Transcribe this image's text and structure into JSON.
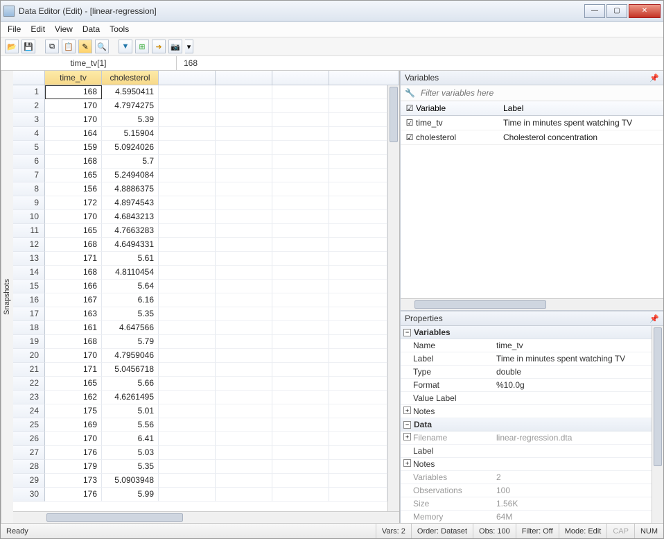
{
  "window": {
    "title": "Data Editor (Edit) - [linear-regression]"
  },
  "menu": [
    "File",
    "Edit",
    "View",
    "Data",
    "Tools"
  ],
  "toolbar_icons": [
    "open",
    "save",
    "copy",
    "paste",
    "editor-edit",
    "editor-browse",
    "filter",
    "vars-mgr",
    "find",
    "snapshot",
    "print"
  ],
  "cellbar": {
    "name": "time_tv[1]",
    "value": "168"
  },
  "columns": [
    "time_tv",
    "cholesterol"
  ],
  "rows": [
    {
      "n": 1,
      "time_tv": "168",
      "chol": "4.5950411"
    },
    {
      "n": 2,
      "time_tv": "170",
      "chol": "4.7974275"
    },
    {
      "n": 3,
      "time_tv": "170",
      "chol": "5.39"
    },
    {
      "n": 4,
      "time_tv": "164",
      "chol": "5.15904"
    },
    {
      "n": 5,
      "time_tv": "159",
      "chol": "5.0924026"
    },
    {
      "n": 6,
      "time_tv": "168",
      "chol": "5.7"
    },
    {
      "n": 7,
      "time_tv": "165",
      "chol": "5.2494084"
    },
    {
      "n": 8,
      "time_tv": "156",
      "chol": "4.8886375"
    },
    {
      "n": 9,
      "time_tv": "172",
      "chol": "4.8974543"
    },
    {
      "n": 10,
      "time_tv": "170",
      "chol": "4.6843213"
    },
    {
      "n": 11,
      "time_tv": "165",
      "chol": "4.7663283"
    },
    {
      "n": 12,
      "time_tv": "168",
      "chol": "4.6494331"
    },
    {
      "n": 13,
      "time_tv": "171",
      "chol": "5.61"
    },
    {
      "n": 14,
      "time_tv": "168",
      "chol": "4.8110454"
    },
    {
      "n": 15,
      "time_tv": "166",
      "chol": "5.64"
    },
    {
      "n": 16,
      "time_tv": "167",
      "chol": "6.16"
    },
    {
      "n": 17,
      "time_tv": "163",
      "chol": "5.35"
    },
    {
      "n": 18,
      "time_tv": "161",
      "chol": "4.647566"
    },
    {
      "n": 19,
      "time_tv": "168",
      "chol": "5.79"
    },
    {
      "n": 20,
      "time_tv": "170",
      "chol": "4.7959046"
    },
    {
      "n": 21,
      "time_tv": "171",
      "chol": "5.0456718"
    },
    {
      "n": 22,
      "time_tv": "165",
      "chol": "5.66"
    },
    {
      "n": 23,
      "time_tv": "162",
      "chol": "4.6261495"
    },
    {
      "n": 24,
      "time_tv": "175",
      "chol": "5.01"
    },
    {
      "n": 25,
      "time_tv": "169",
      "chol": "5.56"
    },
    {
      "n": 26,
      "time_tv": "170",
      "chol": "6.41"
    },
    {
      "n": 27,
      "time_tv": "176",
      "chol": "5.03"
    },
    {
      "n": 28,
      "time_tv": "179",
      "chol": "5.35"
    },
    {
      "n": 29,
      "time_tv": "173",
      "chol": "5.0903948"
    },
    {
      "n": 30,
      "time_tv": "176",
      "chol": "5.99"
    }
  ],
  "snapshots_label": "Snapshots",
  "variables_pane": {
    "title": "Variables",
    "filter_placeholder": "Filter variables here",
    "head_variable": "Variable",
    "head_label": "Label",
    "items": [
      {
        "name": "time_tv",
        "label": "Time in minutes spent watching TV"
      },
      {
        "name": "cholesterol",
        "label": "Cholesterol concentration"
      }
    ]
  },
  "properties_pane": {
    "title": "Properties",
    "sections": {
      "variables": {
        "title": "Variables",
        "rows": [
          {
            "k": "Name",
            "v": "time_tv"
          },
          {
            "k": "Label",
            "v": "Time in minutes spent watching TV"
          },
          {
            "k": "Type",
            "v": "double"
          },
          {
            "k": "Format",
            "v": "%10.0g"
          },
          {
            "k": "Value Label",
            "v": ""
          },
          {
            "k": "Notes",
            "v": "",
            "expand": true
          }
        ]
      },
      "data": {
        "title": "Data",
        "rows": [
          {
            "k": "Filename",
            "v": "linear-regression.dta",
            "gray": true,
            "expand": true
          },
          {
            "k": "Label",
            "v": ""
          },
          {
            "k": "Notes",
            "v": "",
            "expand": true
          },
          {
            "k": "Variables",
            "v": "2",
            "gray": true
          },
          {
            "k": "Observations",
            "v": "100",
            "gray": true
          },
          {
            "k": "Size",
            "v": "1.56K",
            "gray": true
          },
          {
            "k": "Memory",
            "v": "64M",
            "gray": true
          }
        ]
      }
    }
  },
  "status": {
    "ready": "Ready",
    "vars": "Vars: 2",
    "order": "Order: Dataset",
    "obs": "Obs: 100",
    "filter": "Filter: Off",
    "mode": "Mode: Edit",
    "cap": "CAP",
    "num": "NUM"
  }
}
